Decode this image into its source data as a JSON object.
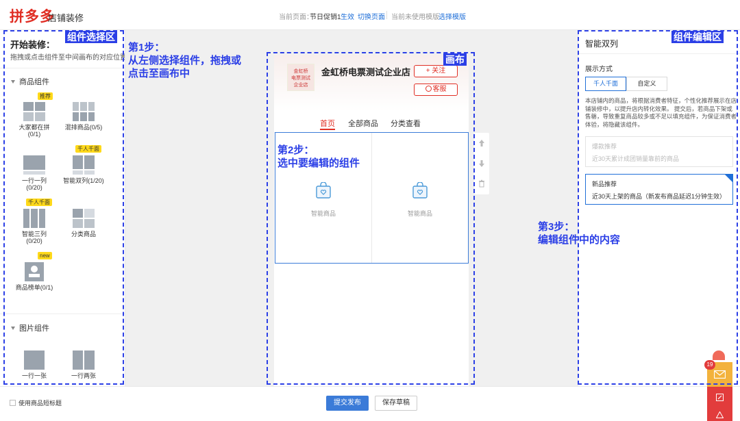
{
  "header": {
    "logo": "拼多多",
    "subtitle": "店铺装修",
    "current_page_label": "当前页面：",
    "current_page_name": "节日促销1",
    "status": "生效",
    "switch_page": "切换页面",
    "template_label": "当前未使用模版",
    "choose_template": "选择模版"
  },
  "left_panel": {
    "title": "开始装修：",
    "hint": "拖拽或点击组件至中间画布的对应位置",
    "sections": [
      {
        "title": "商品组件"
      },
      {
        "title": "图片组件"
      }
    ],
    "components": [
      {
        "label": "大家都在拼\n(0/1)",
        "badge": "推荐",
        "icon": "grid-2x2-icon"
      },
      {
        "label": "混排商品(0/5)",
        "badge": "",
        "icon": "mixed-grid-icon"
      },
      {
        "label": "一行一列\n(0/20)",
        "badge": "",
        "icon": "single-column-icon"
      },
      {
        "label": "智能双列(1/20)",
        "badge": "千人千面",
        "icon": "two-column-icon"
      },
      {
        "label": "智能三列\n(0/20)",
        "badge": "千人千面",
        "icon": "three-column-icon"
      },
      {
        "label": "分类商品",
        "badge": "",
        "icon": "category-icon"
      },
      {
        "label": "商品榜单(0/1)",
        "badge": "new",
        "icon": "ranking-icon"
      },
      {
        "label": "一行一张",
        "badge": "",
        "icon": "single-image-icon"
      },
      {
        "label": "一行两张",
        "badge": "",
        "icon": "double-image-icon"
      }
    ]
  },
  "preview": {
    "shop_logo_text": "金虹桥\n电票测试\n企业店",
    "shop_name": "金虹桥电票测试企业店",
    "follow_button": "+ 关注",
    "service_button": "客服",
    "tabs": [
      "首页",
      "全部商品",
      "分类查看"
    ],
    "product_label": "智能商品"
  },
  "right_panel": {
    "title": "智能双列",
    "display_label": "展示方式",
    "modes": [
      "千人千面",
      "自定义"
    ],
    "description": "本店铺内的商品，将根据消费者特征，个性化推荐展示在店铺装修中，以提升店内转化效果。 提交后，若商品下架或售罄，导致重复商品较多或不足以填充组件，为保证消费者体验，将隐藏该组件。",
    "options": [
      {
        "title": "爆款推荐",
        "desc": "近30天累计成团销量靠前的商品"
      },
      {
        "title": "新品推荐",
        "desc": "近30天上架的商品（新发布商品延迟1分钟生效）"
      }
    ]
  },
  "annotations": {
    "left_tag": "组件选择区",
    "canvas_tag": "画布",
    "right_tag": "组件编辑区",
    "step1": "第1步：\n从左侧选择组件，拖拽或\n点击至画布中",
    "step2": "第2步：\n选中要编辑的组件",
    "step3": "第3步：\n编辑组件中的内容"
  },
  "footer": {
    "checkbox_label": "使用商品短标题",
    "publish": "提交发布",
    "save_draft": "保存草稿"
  },
  "widget": {
    "badge_count": "19"
  },
  "colors": {
    "brand_red": "#e02e24",
    "link_blue": "#1f6fd8",
    "annotation_blue": "#2b3fe6",
    "primary_button": "#3b7bd8"
  }
}
